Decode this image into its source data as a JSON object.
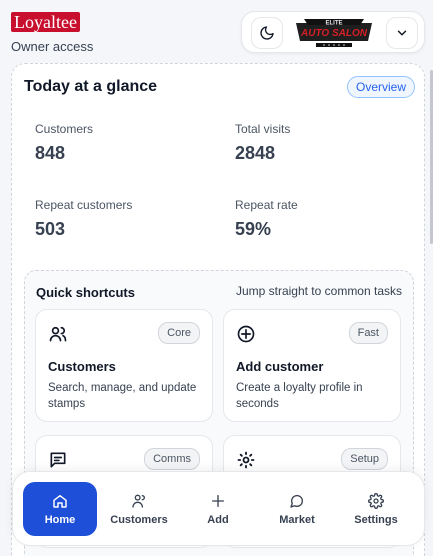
{
  "header": {
    "logo_text": "Loyaltee",
    "subtitle": "Owner access",
    "brand_logo_text": {
      "top": "ELITE",
      "main": "AUTO SALON"
    }
  },
  "glance": {
    "title": "Today at a glance",
    "badge": "Overview",
    "stats": [
      {
        "label": "Customers",
        "value": "848"
      },
      {
        "label": "Total visits",
        "value": "2848"
      },
      {
        "label": "Repeat customers",
        "value": "503"
      },
      {
        "label": "Repeat rate",
        "value": "59%"
      }
    ]
  },
  "shortcuts": {
    "title": "Quick shortcuts",
    "subtitle": "Jump straight to common tasks",
    "cards": [
      {
        "title": "Customers",
        "badge": "Core",
        "description": "Search, manage, and update stamps",
        "icon": "users-icon"
      },
      {
        "title": "Add customer",
        "badge": "Fast",
        "description": "Create a loyalty profile in seconds",
        "icon": "plus-circle-icon"
      },
      {
        "title": "",
        "badge": "Comms",
        "description": "",
        "icon": "message-icon"
      },
      {
        "title": "",
        "badge": "Setup",
        "description": "",
        "icon": "gear-icon"
      }
    ]
  },
  "nav": {
    "items": [
      {
        "label": "Home",
        "icon": "home-icon",
        "active": true
      },
      {
        "label": "Customers",
        "icon": "customers-icon",
        "active": false
      },
      {
        "label": "Add",
        "icon": "plus-icon",
        "active": false
      },
      {
        "label": "Market",
        "icon": "chat-icon",
        "active": false
      },
      {
        "label": "Settings",
        "icon": "gear-icon",
        "active": false
      }
    ]
  },
  "colors": {
    "brand_red": "#c8102e",
    "accent_blue": "#1d4fd8"
  }
}
